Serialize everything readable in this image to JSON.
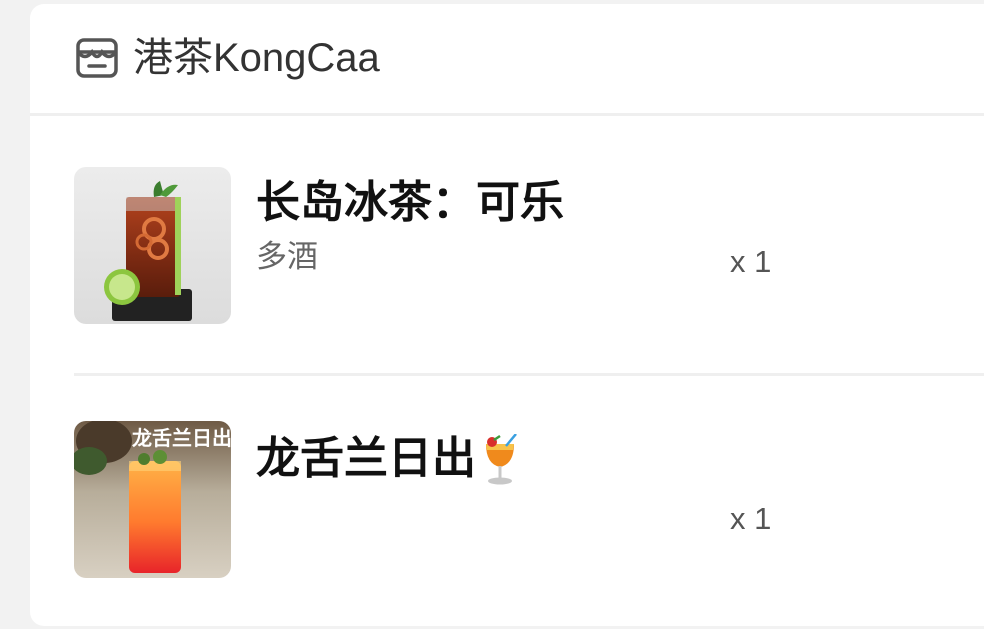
{
  "store": {
    "name": "港茶KongCaa",
    "icon": "store-icon"
  },
  "items": [
    {
      "title": "长岛冰茶：可乐",
      "subtitle": "多酒",
      "quantity": "x 1",
      "image": "long-island-iced-tea-image"
    },
    {
      "title": "龙舌兰日出",
      "title_icon": "tropical-drink-icon",
      "subtitle": "",
      "quantity": "x 1",
      "image": "tequila-sunrise-image",
      "image_caption": "龙舌兰日出"
    }
  ],
  "colors": {
    "background": "#f2f2f2",
    "card": "#ffffff",
    "divider": "#efefef",
    "title": "#111111",
    "secondary": "#666666"
  }
}
